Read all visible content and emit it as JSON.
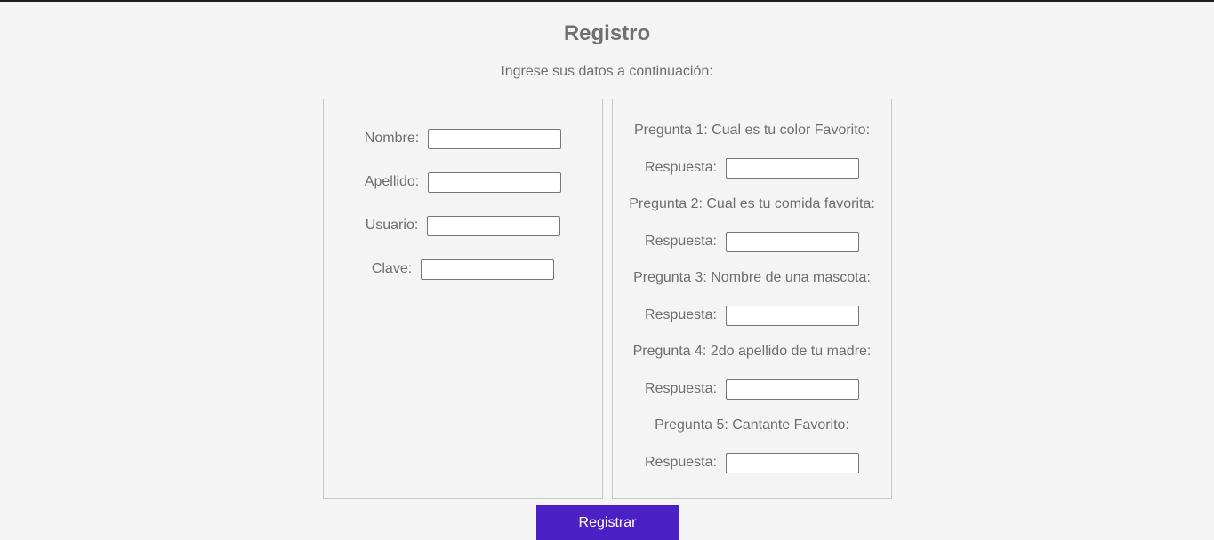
{
  "page": {
    "title": "Registro",
    "subtitle": "Ingrese sus datos a continuación:"
  },
  "personal": {
    "fields": [
      {
        "label": "Nombre:",
        "value": ""
      },
      {
        "label": "Apellido:",
        "value": ""
      },
      {
        "label": "Usuario:",
        "value": ""
      },
      {
        "label": "Clave:",
        "value": ""
      }
    ]
  },
  "security": {
    "answer_label": "Respuesta:",
    "questions": [
      {
        "text": "Pregunta 1: Cual es tu color Favorito:",
        "answer": ""
      },
      {
        "text": "Pregunta 2: Cual es tu comida favorita:",
        "answer": ""
      },
      {
        "text": "Pregunta 3: Nombre de una mascota:",
        "answer": ""
      },
      {
        "text": "Pregunta 4: 2do apellido de tu madre:",
        "answer": ""
      },
      {
        "text": "Pregunta 5: Cantante Favorito:",
        "answer": ""
      }
    ]
  },
  "actions": {
    "submit_label": "Registrar"
  },
  "colors": {
    "background": "#f4f4f4",
    "text": "#6e6e6e",
    "button": "#4b21c6",
    "button_text": "#ffffff"
  }
}
